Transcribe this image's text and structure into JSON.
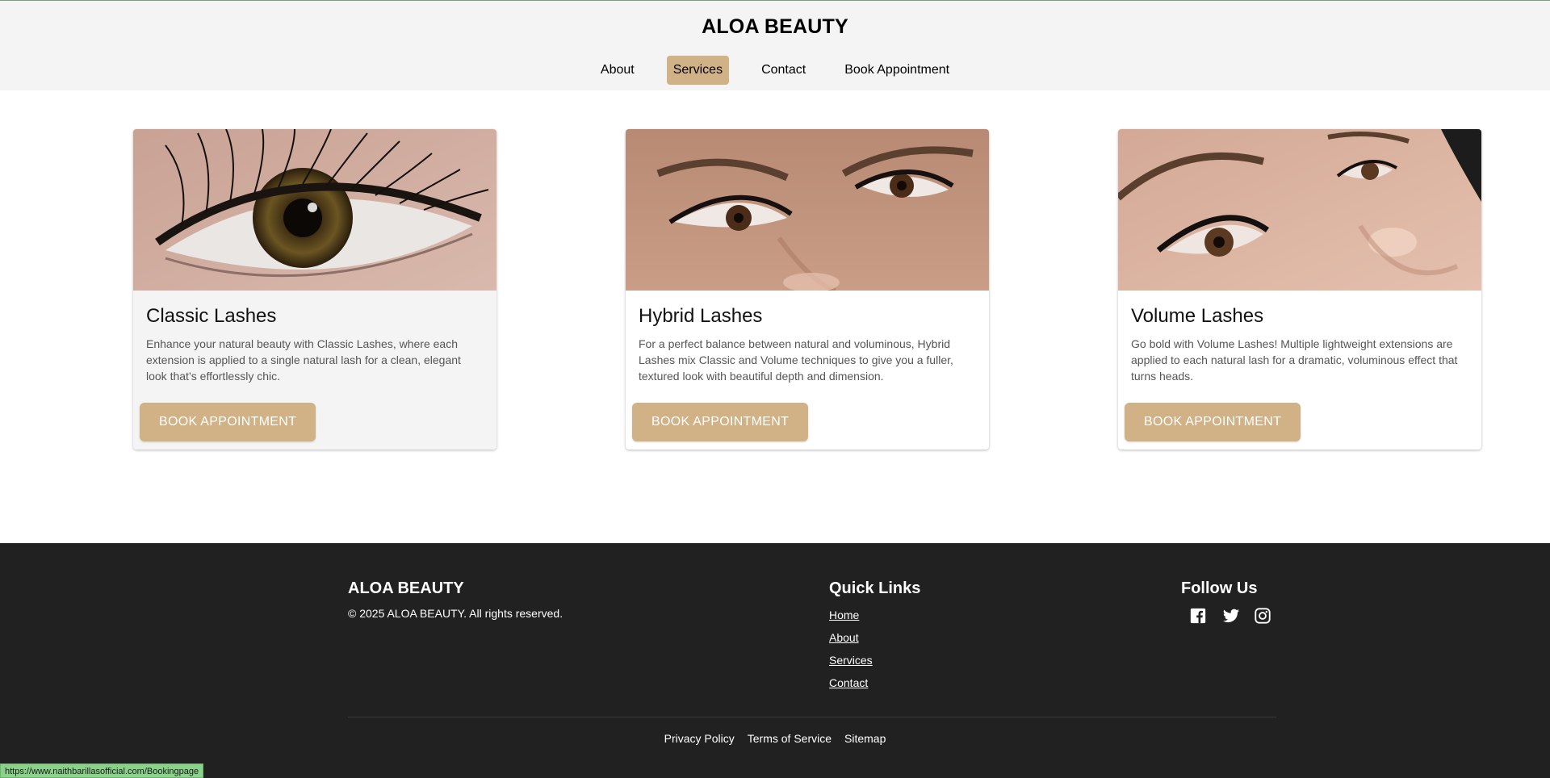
{
  "header": {
    "brand": "ALOA BEAUTY",
    "nav": [
      {
        "label": "About",
        "active": false
      },
      {
        "label": "Services",
        "active": true
      },
      {
        "label": "Contact",
        "active": false
      },
      {
        "label": "Book Appointment",
        "active": false
      }
    ]
  },
  "services": [
    {
      "title": "Classic Lashes",
      "description": "Enhance your natural beauty with Classic Lashes, where each extension is applied to a single natural lash for a clean, elegant look that’s effortlessly chic.",
      "button": "BOOK APPOINTMENT"
    },
    {
      "title": "Hybrid Lashes",
      "description": "For a perfect balance between natural and voluminous, Hybrid Lashes mix Classic and Volume techniques to give you a fuller, textured look with beautiful depth and dimension.",
      "button": "BOOK APPOINTMENT"
    },
    {
      "title": "Volume Lashes",
      "description": "Go bold with Volume Lashes! Multiple lightweight extensions are applied to each natural lash for a dramatic, voluminous effect that turns heads.",
      "button": "BOOK APPOINTMENT"
    }
  ],
  "footer": {
    "brand": "ALOA BEAUTY",
    "copyright": "© 2025 ALOA BEAUTY. All rights reserved.",
    "quick_links_title": "Quick Links",
    "quick_links": [
      "Home",
      "About",
      "Services",
      "Contact"
    ],
    "follow_title": "Follow Us",
    "social_icons": [
      "facebook-icon",
      "twitter-icon",
      "instagram-icon"
    ],
    "bottom_links": [
      "Privacy Policy",
      "Terms of Service",
      "Sitemap"
    ]
  },
  "status_bar": {
    "url": "https://www.naithbarillasofficial.com/Bookingpage"
  },
  "colors": {
    "accent": "#d1b186",
    "header_bg": "#f4f4f4",
    "footer_bg": "#212121"
  }
}
